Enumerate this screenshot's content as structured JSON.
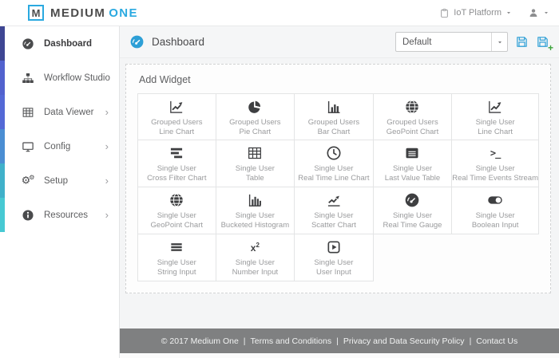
{
  "header": {
    "logo": {
      "mark": "M",
      "brand_primary": "MEDIUM",
      "brand_secondary": "ONE"
    },
    "platform_menu": {
      "label": "IoT Platform",
      "icon": "clipboard-icon"
    },
    "user_menu": {
      "icon": "person-icon"
    }
  },
  "sidebar": {
    "strip_colors": [
      "#3e4693",
      "#5262ce",
      "#5469d6",
      "#4b8ed3",
      "#40b1ca",
      "#47c9d3"
    ],
    "items": [
      {
        "label": "Dashboard",
        "icon": "gauge-filled-icon",
        "active": true,
        "chevron": false
      },
      {
        "label": "Workflow Studio",
        "icon": "sitemap-icon",
        "active": false,
        "chevron": false
      },
      {
        "label": "Data Viewer",
        "icon": "table-icon",
        "active": false,
        "chevron": true
      },
      {
        "label": "Config",
        "icon": "monitor-icon",
        "active": false,
        "chevron": true
      },
      {
        "label": "Setup",
        "icon": "gears-icon",
        "active": false,
        "chevron": true
      },
      {
        "label": "Resources",
        "icon": "info-icon",
        "active": false,
        "chevron": true
      }
    ]
  },
  "main": {
    "title": "Dashboard",
    "title_icon": "gauge-filled-icon",
    "dashboard_select": {
      "value": "Default"
    },
    "save_button": {
      "icon": "floppy-icon"
    },
    "save_as_button": {
      "icon": "floppy-plus-icon"
    },
    "add_widget": {
      "title": "Add Widget",
      "widgets": [
        {
          "group": "Grouped Users",
          "type": "Line Chart",
          "icon": "line-chart-icon"
        },
        {
          "group": "Grouped Users",
          "type": "Pie Chart",
          "icon": "pie-chart-icon"
        },
        {
          "group": "Grouped Users",
          "type": "Bar Chart",
          "icon": "bar-chart-icon"
        },
        {
          "group": "Grouped Users",
          "type": "GeoPoint Chart",
          "icon": "globe-icon"
        },
        {
          "group": "Single User",
          "type": "Line Chart",
          "icon": "line-chart-icon"
        },
        {
          "group": "Single User",
          "type": "Cross Filter Chart",
          "icon": "cross-filter-icon"
        },
        {
          "group": "Single User",
          "type": "Table",
          "icon": "table-icon"
        },
        {
          "group": "Single User",
          "type": "Real Time Line Chart",
          "icon": "clock-icon"
        },
        {
          "group": "Single User",
          "type": "Last Value Table",
          "icon": "list-table-icon"
        },
        {
          "group": "Single User",
          "type": "Real Time Events Stream",
          "icon": "terminal-icon"
        },
        {
          "group": "Single User",
          "type": "GeoPoint Chart",
          "icon": "globe-icon"
        },
        {
          "group": "Single User",
          "type": "Bucketed Histogram",
          "icon": "histogram-icon"
        },
        {
          "group": "Single User",
          "type": "Scatter Chart",
          "icon": "scatter-icon"
        },
        {
          "group": "Single User",
          "type": "Real Time Gauge",
          "icon": "gauge-filled-icon"
        },
        {
          "group": "Single User",
          "type": "Boolean Input",
          "icon": "toggle-icon"
        },
        {
          "group": "Single User",
          "type": "String Input",
          "icon": "lines-icon"
        },
        {
          "group": "Single User",
          "type": "Number Input",
          "icon": "x2-icon"
        },
        {
          "group": "Single User",
          "type": "User Input",
          "icon": "play-box-icon"
        }
      ]
    }
  },
  "footer": {
    "copyright": "© 2017 Medium One",
    "separator": "|",
    "links": [
      "Terms and Conditions",
      "Privacy and Data Security Policy",
      "Contact Us"
    ]
  },
  "colors": {
    "accent_blue": "#2aa9e0",
    "save_icon_blue": "#2d9fd6",
    "plus_green": "#3ca33c",
    "footer_bg": "#7f8081",
    "main_bg": "#f4f5f6"
  }
}
